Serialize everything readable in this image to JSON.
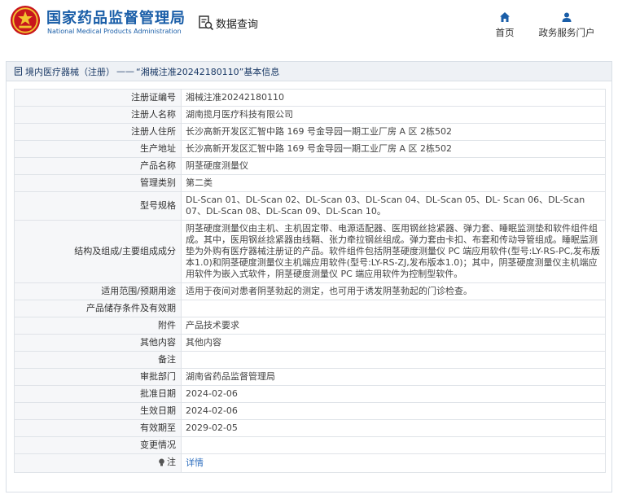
{
  "header": {
    "brand_cn": "国家药品监督管理局",
    "brand_en": "National Medical Products Administration",
    "search_label": "数据查询",
    "nav": {
      "home": "首页",
      "service": "政务服务门户"
    }
  },
  "panel": {
    "title_prefix": "境内医疗器械（注册）",
    "title_sep": "——",
    "title_main": "“湘械注准20242180110”基本信息"
  },
  "rows": [
    {
      "label": "注册证编号",
      "value": "湘械注准20242180110"
    },
    {
      "label": "注册人名称",
      "value": "湖南揽月医疗科技有限公司"
    },
    {
      "label": "注册人住所",
      "value": "长沙高新开发区汇智中路 169 号金导园一期工业厂房 A 区 2栋502"
    },
    {
      "label": "生产地址",
      "value": "长沙高新开发区汇智中路 169 号金导园一期工业厂房 A 区 2栋502"
    },
    {
      "label": "产品名称",
      "value": "阴茎硬度测量仪"
    },
    {
      "label": "管理类别",
      "value": "第二类"
    },
    {
      "label": "型号规格",
      "value": "DL-Scan 01、DL-Scan 02、DL-Scan 03、DL-Scan 04、DL-Scan 05、DL- Scan 06、DL-Scan 07、DL-Scan 08、DL-Scan 09、DL-Scan 10。"
    },
    {
      "label": "结构及组成/主要组成成分",
      "value": "阴茎硬度测量仪由主机、主机固定带、电源适配器、医用钢丝捻紧器、弹力套、睡眠监测垫和软件组件组成。其中，医用钢丝捻紧器由线鞘、张力牵拉钢丝组成。弹力套由卡扣、布套和传动导管组成。睡眠监测垫为外购有医疗器械注册证的产品。软件组件包括阴茎硬度测量仪 PC 端应用软件(型号:LY-RS-PC,发布版本1.0)和阴茎硬度测量仪主机端应用软件(型号:LY-RS-ZJ,发布版本1.0)；其中，阴茎硬度测量仪主机端应用软件为嵌入式软件，阴茎硬度测量仪 PC 端应用软件为控制型软件。"
    },
    {
      "label": "适用范围/预期用途",
      "value": "适用于夜间对患者阴茎勃起的测定，也可用于诱发阴茎勃起的门诊检查。"
    },
    {
      "label": "产品储存条件及有效期",
      "value": ""
    },
    {
      "label": "附件",
      "value": "产品技术要求"
    },
    {
      "label": "其他内容",
      "value": "其他内容"
    },
    {
      "label": "备注",
      "value": ""
    },
    {
      "label": "审批部门",
      "value": "湖南省药品监督管理局"
    },
    {
      "label": "批准日期",
      "value": "2024-02-06"
    },
    {
      "label": "生效日期",
      "value": "2024-02-06"
    },
    {
      "label": "有效期至",
      "value": "2029-02-05"
    },
    {
      "label": "变更情况",
      "value": ""
    }
  ],
  "note_row": {
    "label": "注",
    "link": "详情"
  },
  "colors": {
    "brand": "#1a5ea8",
    "link": "#2f6fbf",
    "label_bg": "#f6f7f9",
    "title_bg": "#eef1f5"
  },
  "icons": [
    "emblem-icon",
    "search-doc-icon",
    "home-icon",
    "user-icon",
    "document-icon",
    "bulb-icon"
  ]
}
